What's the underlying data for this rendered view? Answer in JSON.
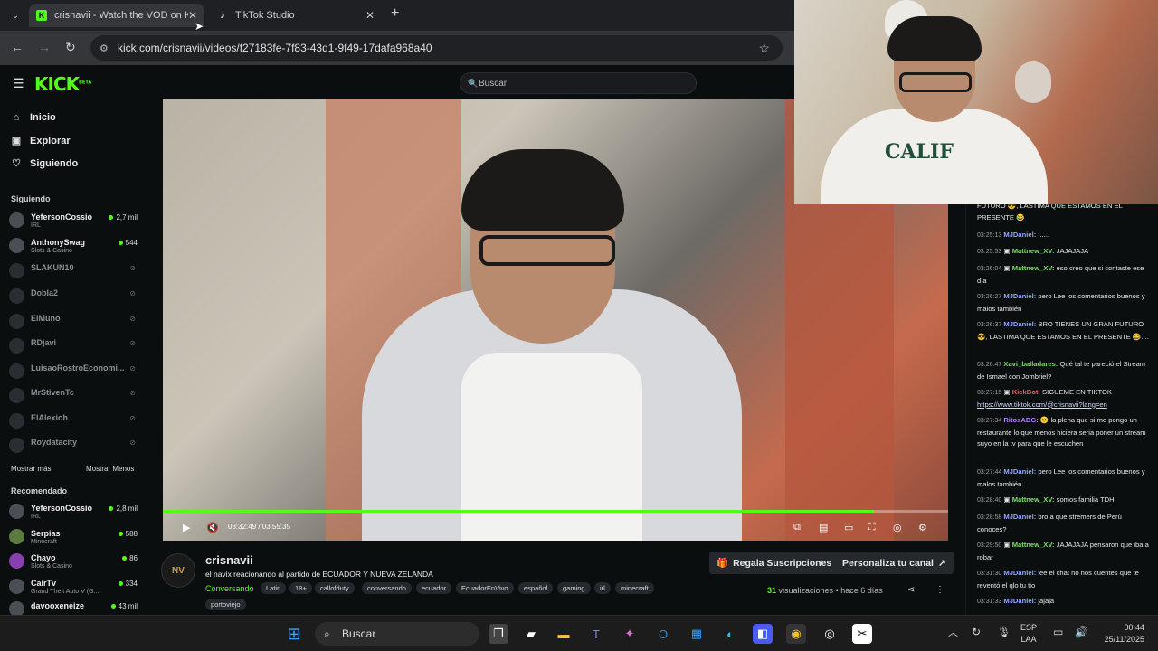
{
  "browser": {
    "tabs": [
      {
        "title": "crisnavii - Watch the VOD on Ki",
        "close": "✕"
      },
      {
        "title": "TikTok Studio",
        "close": "✕"
      }
    ],
    "new_tab": "+",
    "url": "kick.com/crisnavii/videos/f27183fe-7f83-43d1-9f49-17dafa968a40"
  },
  "kick": {
    "logo": "KICK",
    "logo_badge": "BETA",
    "search_placeholder": "Buscar"
  },
  "sidebar": {
    "nav": [
      {
        "label": "Inicio",
        "icon": "home-icon"
      },
      {
        "label": "Explorar",
        "icon": "compass-icon"
      },
      {
        "label": "Siguiendo",
        "icon": "heart-icon"
      }
    ],
    "following_label": "Siguiendo",
    "following": [
      {
        "name": "YefersonCossio",
        "category": "IRL",
        "viewers": "2,7 mil",
        "live": true
      },
      {
        "name": "AnthonySwag",
        "category": "Slots & Casino",
        "viewers": "544",
        "live": true
      },
      {
        "name": "SLAKUN10",
        "category": "",
        "viewers": "",
        "live": false
      },
      {
        "name": "Dobla2",
        "category": "",
        "viewers": "",
        "live": false
      },
      {
        "name": "ElMuno",
        "category": "",
        "viewers": "",
        "live": false
      },
      {
        "name": "RDjavi",
        "category": "",
        "viewers": "",
        "live": false
      },
      {
        "name": "LuisaoRostroEconomi...",
        "category": "",
        "viewers": "",
        "live": false
      },
      {
        "name": "MrStivenTc",
        "category": "",
        "viewers": "",
        "live": false
      },
      {
        "name": "ElAlexioh",
        "category": "",
        "viewers": "",
        "live": false
      },
      {
        "name": "Roydatacity",
        "category": "",
        "viewers": "",
        "live": false
      }
    ],
    "show_more": "Mostrar más",
    "show_less": "Mostrar Menos",
    "recommended_label": "Recomendado",
    "recommended": [
      {
        "name": "YefersonCossio",
        "category": "IRL",
        "viewers": "2,8 mil"
      },
      {
        "name": "Serpias",
        "category": "Minecraft",
        "viewers": "588"
      },
      {
        "name": "Chayo",
        "category": "Slots & Casino",
        "viewers": "86"
      },
      {
        "name": "CairTv",
        "category": "Grand Theft Auto V (G...",
        "viewers": "334"
      },
      {
        "name": "davooxeneize",
        "category": "",
        "viewers": "43 mil"
      }
    ]
  },
  "player": {
    "time_current": "03:32:49",
    "time_total": "03:55:35",
    "progress": 0.906
  },
  "info": {
    "channel_logo": "NV",
    "channel": "crisnavii",
    "title": "el navix reacionando al partido  de  ECUADOR Y NUEVA ZELANDA",
    "category": "Conversando",
    "tags": [
      "Latin",
      "18+",
      "callofduty",
      "conversando",
      "ecuador",
      "EcuadorEnVivo",
      "español",
      "gaming",
      "irl",
      "minecraft",
      "portoviejo"
    ],
    "gift_btn": "Regala Suscripciones",
    "customize_btn": "Personaliza tu canal",
    "views_count": "31",
    "views_label": "visualizaciones",
    "ago": "hace 6 días"
  },
  "chat": [
    {
      "ts": "",
      "user": "",
      "color": "#ffffff",
      "text": "FUTURO 😎, LASTIMA QUE ESTAMOS EN EL PRESENTE 😂"
    },
    {
      "ts": "03:25:13",
      "user": "MJDaniel:",
      "color": "#8ea4ff",
      "text": "......"
    },
    {
      "ts": "03:25:53",
      "user": "Mattnew_XV:",
      "color": "#7dde6c",
      "text": "JAJAJAJA"
    },
    {
      "ts": "03:26:04",
      "user": "Mattnew_XV:",
      "color": "#7dde6c",
      "text": "eso creo que si contaste ese día"
    },
    {
      "ts": "03:26:27",
      "user": "MJDaniel:",
      "color": "#8ea4ff",
      "text": "pero Lee los comentarios buenos y malos también"
    },
    {
      "ts": "03:26:37",
      "user": "MJDaniel:",
      "color": "#8ea4ff",
      "text": "BRO TIENES UN GRAN FUTURO 😎, LASTIMA QUE ESTAMOS EN EL PRESENTE 😂...."
    },
    {
      "ts": "03:26:47",
      "user": "Xavi_balladares:",
      "color": "#7dde6c",
      "text": "Qué tal te pareció el Stream de Ismael con Jombriel?"
    },
    {
      "ts": "03:27:15",
      "user": "KickBot:",
      "color": "#ff5a5a",
      "text": "SIGUEME EN TIKTOK",
      "link": "https://www.tiktok.com/@crisnavii?lang=en"
    },
    {
      "ts": "03:27:34",
      "user": "RitosADG:",
      "color": "#b77cff",
      "text": "la plena que si me pongo un restaurante lo que menos hiciera seria poner un stream suyo en la tv para que le escuchen"
    },
    {
      "ts": "03:27:44",
      "user": "MJDaniel:",
      "color": "#8ea4ff",
      "text": "pero Lee los comentarios buenos y malos también"
    },
    {
      "ts": "03:28:40",
      "user": "Mattnew_XV:",
      "color": "#7dde6c",
      "text": "somos familia TDH"
    },
    {
      "ts": "03:28:58",
      "user": "MJDaniel:",
      "color": "#8ea4ff",
      "text": "bro a que stremers de Perú conoces?"
    },
    {
      "ts": "03:29:50",
      "user": "Mattnew_XV:",
      "color": "#7dde6c",
      "text": "JAJAJAJA pensaron que iba a robar"
    },
    {
      "ts": "03:31:30",
      "user": "MJDaniel:",
      "color": "#8ea4ff",
      "text": "lee el chat no nos cuentes que te reventó el qlo tu tio"
    },
    {
      "ts": "03:31:33",
      "user": "MJDaniel:",
      "color": "#8ea4ff",
      "text": "jajaja"
    }
  ],
  "webcam": {
    "shirt_text": "CALIF"
  },
  "taskbar": {
    "search": "Buscar",
    "lang": "ESP",
    "region": "LAA",
    "time": "00:44",
    "date": "25/11/2025"
  }
}
